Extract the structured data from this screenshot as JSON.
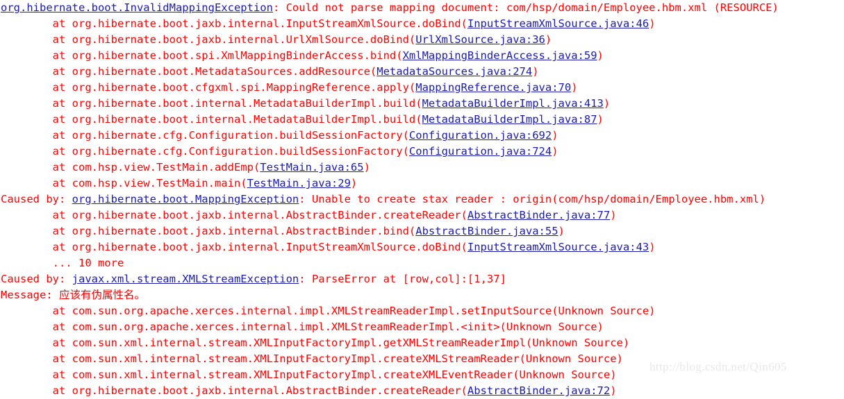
{
  "console": {
    "background_color": "#ffffff",
    "error_color": "#ff0000",
    "link_color": "#1b1bb0",
    "watermark": "http://blog.csdn.net/Qin605",
    "lines": [
      {
        "id": "line-1",
        "segments": [
          {
            "text": "org.hibernate.boot.InvalidMappingException",
            "kind": "link"
          },
          {
            "text": ": Could not parse mapping document: com/hsp/domain/Employee.hbm.xml (RESOURCE)",
            "kind": "err"
          }
        ]
      },
      {
        "id": "line-2",
        "segments": [
          {
            "text": "\tat org.hibernate.boot.jaxb.internal.InputStreamXmlSource.doBind(",
            "kind": "err"
          },
          {
            "text": "InputStreamXmlSource.java:46",
            "kind": "link"
          },
          {
            "text": ")",
            "kind": "err"
          }
        ]
      },
      {
        "id": "line-3",
        "segments": [
          {
            "text": "\tat org.hibernate.boot.jaxb.internal.UrlXmlSource.doBind(",
            "kind": "err"
          },
          {
            "text": "UrlXmlSource.java:36",
            "kind": "link"
          },
          {
            "text": ")",
            "kind": "err"
          }
        ]
      },
      {
        "id": "line-4",
        "segments": [
          {
            "text": "\tat org.hibernate.boot.spi.XmlMappingBinderAccess.bind(",
            "kind": "err"
          },
          {
            "text": "XmlMappingBinderAccess.java:59",
            "kind": "link"
          },
          {
            "text": ")",
            "kind": "err"
          }
        ]
      },
      {
        "id": "line-5",
        "segments": [
          {
            "text": "\tat org.hibernate.boot.MetadataSources.addResource(",
            "kind": "err"
          },
          {
            "text": "MetadataSources.java:274",
            "kind": "link"
          },
          {
            "text": ")",
            "kind": "err"
          }
        ]
      },
      {
        "id": "line-6",
        "segments": [
          {
            "text": "\tat org.hibernate.boot.cfgxml.spi.MappingReference.apply(",
            "kind": "err"
          },
          {
            "text": "MappingReference.java:70",
            "kind": "link"
          },
          {
            "text": ")",
            "kind": "err"
          }
        ]
      },
      {
        "id": "line-7",
        "segments": [
          {
            "text": "\tat org.hibernate.boot.internal.MetadataBuilderImpl.build(",
            "kind": "err"
          },
          {
            "text": "MetadataBuilderImpl.java:413",
            "kind": "link"
          },
          {
            "text": ")",
            "kind": "err"
          }
        ]
      },
      {
        "id": "line-8",
        "segments": [
          {
            "text": "\tat org.hibernate.boot.internal.MetadataBuilderImpl.build(",
            "kind": "err"
          },
          {
            "text": "MetadataBuilderImpl.java:87",
            "kind": "link"
          },
          {
            "text": ")",
            "kind": "err"
          }
        ]
      },
      {
        "id": "line-9",
        "segments": [
          {
            "text": "\tat org.hibernate.cfg.Configuration.buildSessionFactory(",
            "kind": "err"
          },
          {
            "text": "Configuration.java:692",
            "kind": "link"
          },
          {
            "text": ")",
            "kind": "err"
          }
        ]
      },
      {
        "id": "line-10",
        "segments": [
          {
            "text": "\tat org.hibernate.cfg.Configuration.buildSessionFactory(",
            "kind": "err"
          },
          {
            "text": "Configuration.java:724",
            "kind": "link"
          },
          {
            "text": ")",
            "kind": "err"
          }
        ]
      },
      {
        "id": "line-11",
        "segments": [
          {
            "text": "\tat com.hsp.view.TestMain.addEmp(",
            "kind": "err"
          },
          {
            "text": "TestMain.java:65",
            "kind": "link"
          },
          {
            "text": ")",
            "kind": "err"
          }
        ]
      },
      {
        "id": "line-12",
        "segments": [
          {
            "text": "\tat com.hsp.view.TestMain.main(",
            "kind": "err"
          },
          {
            "text": "TestMain.java:29",
            "kind": "link"
          },
          {
            "text": ")",
            "kind": "err"
          }
        ]
      },
      {
        "id": "line-13",
        "segments": [
          {
            "text": "Caused by: ",
            "kind": "err"
          },
          {
            "text": "org.hibernate.boot.MappingException",
            "kind": "link"
          },
          {
            "text": ": Unable to create stax reader : origin(com/hsp/domain/Employee.hbm.xml)",
            "kind": "err"
          }
        ]
      },
      {
        "id": "line-14",
        "segments": [
          {
            "text": "\tat org.hibernate.boot.jaxb.internal.AbstractBinder.createReader(",
            "kind": "err"
          },
          {
            "text": "AbstractBinder.java:77",
            "kind": "link"
          },
          {
            "text": ")",
            "kind": "err"
          }
        ]
      },
      {
        "id": "line-15",
        "segments": [
          {
            "text": "\tat org.hibernate.boot.jaxb.internal.AbstractBinder.bind(",
            "kind": "err"
          },
          {
            "text": "AbstractBinder.java:55",
            "kind": "link"
          },
          {
            "text": ")",
            "kind": "err"
          }
        ]
      },
      {
        "id": "line-16",
        "segments": [
          {
            "text": "\tat org.hibernate.boot.jaxb.internal.InputStreamXmlSource.doBind(",
            "kind": "err"
          },
          {
            "text": "InputStreamXmlSource.java:43",
            "kind": "link"
          },
          {
            "text": ")",
            "kind": "err"
          }
        ]
      },
      {
        "id": "line-17",
        "segments": [
          {
            "text": "\t... 10 more",
            "kind": "err"
          }
        ]
      },
      {
        "id": "line-18",
        "segments": [
          {
            "text": "Caused by: ",
            "kind": "err"
          },
          {
            "text": "javax.xml.stream.XMLStreamException",
            "kind": "link"
          },
          {
            "text": ": ParseError at [row,col]:[1,37]",
            "kind": "err"
          }
        ]
      },
      {
        "id": "line-19",
        "segments": [
          {
            "text": "Message: 应该有伪属性名。",
            "kind": "err"
          }
        ]
      },
      {
        "id": "line-20",
        "segments": [
          {
            "text": "\tat com.sun.org.apache.xerces.internal.impl.XMLStreamReaderImpl.setInputSource(Unknown Source)",
            "kind": "err"
          }
        ]
      },
      {
        "id": "line-21",
        "segments": [
          {
            "text": "\tat com.sun.org.apache.xerces.internal.impl.XMLStreamReaderImpl.<init>(Unknown Source)",
            "kind": "err"
          }
        ]
      },
      {
        "id": "line-22",
        "segments": [
          {
            "text": "\tat com.sun.xml.internal.stream.XMLInputFactoryImpl.getXMLStreamReaderImpl(Unknown Source)",
            "kind": "err"
          }
        ]
      },
      {
        "id": "line-23",
        "segments": [
          {
            "text": "\tat com.sun.xml.internal.stream.XMLInputFactoryImpl.createXMLStreamReader(Unknown Source)",
            "kind": "err"
          }
        ]
      },
      {
        "id": "line-24",
        "segments": [
          {
            "text": "\tat com.sun.xml.internal.stream.XMLInputFactoryImpl.createXMLEventReader(Unknown Source)",
            "kind": "err"
          }
        ]
      },
      {
        "id": "line-25",
        "segments": [
          {
            "text": "\tat org.hibernate.boot.jaxb.internal.AbstractBinder.createReader(",
            "kind": "err"
          },
          {
            "text": "AbstractBinder.java:72",
            "kind": "link"
          },
          {
            "text": ")",
            "kind": "err"
          }
        ]
      }
    ]
  }
}
